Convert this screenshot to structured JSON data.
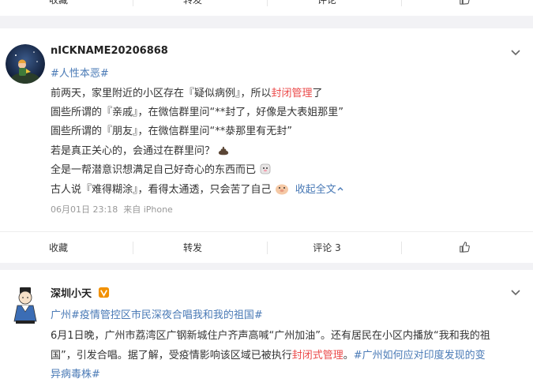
{
  "top_bar": {
    "collect": "收藏",
    "repost": "转发",
    "comment": "评论"
  },
  "post1": {
    "nickname": "nICKNAME20206868",
    "topic": "#人性本恶#",
    "line1_a": "前两天，家里附近的小区存在『疑似病例』，所以",
    "line1_hl": "封闭管理",
    "line1_b": "了",
    "line2": "圄些所谓的『亲戚』，在微信群里问“**封了，好像是大表姐那里”",
    "line3": "圄些所谓的『朋友』，在微信群里问“**㳟那里有无封”",
    "line4": "若是真正关心的，会通过在群里问？",
    "line5": "全是一帮潜意识想满足自己好奇心的东西而已",
    "line6": "古人说『难得糊涂』，看得太通透，只会苦了自己",
    "collapse": "收起全文",
    "time": "06月01日 23:18",
    "source": "来自 iPhone"
  },
  "bar2": {
    "collect": "收藏",
    "repost": "转发",
    "comment": "评论 3"
  },
  "post2": {
    "nickname": "深圳小天",
    "line1_a": "广州",
    "line1_topic": "#疫情管控区市民深夜合唱我和我的祖国#",
    "line2": "6月1日晚，广州市荔湾区广钢新城住户齐声高喊“广州加油”。还有居民在小区内播放“我和我的祖",
    "line3_a": "国”，引发合唱。据了解，受疫情影响该区域已被执行",
    "line3_hl": "封闭式管理",
    "line3_b": "。",
    "line3_topic": "#广州如何应对印度发现的变",
    "line4_topic": "异病毒株#"
  },
  "colors": {
    "topic": "#eb7350",
    "link": "#4a7ab6",
    "highlight": "#eb4a4a",
    "verified": "#f29100"
  }
}
